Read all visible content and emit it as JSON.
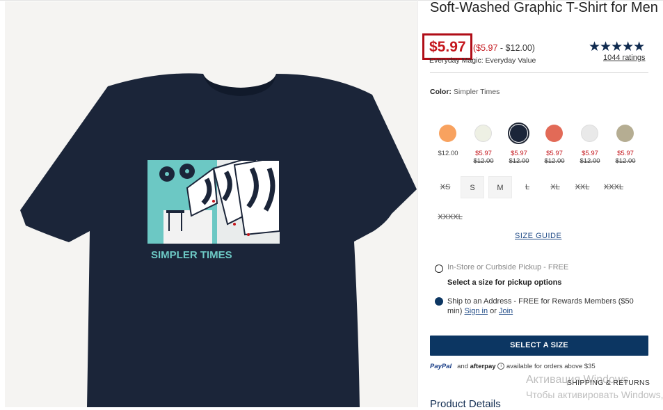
{
  "product": {
    "title": "Soft-Washed Graphic T-Shirt for Men",
    "sale_price": "$5.97",
    "range_low": "($5.97",
    "range_high": " - $12.00)",
    "value_label": "Everyday Magic: Everyday Value",
    "rating_stars": "★★★★★",
    "rating_count": "1044 ratings",
    "graphic_text": "SIMPLER TIMES",
    "image_alt": "Navy t-shirt with arcade graphic"
  },
  "color": {
    "label": "Color:",
    "selected_name": "Simpler Times",
    "swatches": [
      {
        "name": "orange",
        "hex": "#f8a25f",
        "price": "$12.00",
        "old_price": ""
      },
      {
        "name": "cream",
        "hex": "#eef0e4",
        "price": "$5.97",
        "old_price": "$12.00"
      },
      {
        "name": "navy",
        "hex": "#1b2539",
        "price": "$5.97",
        "old_price": "$12.00"
      },
      {
        "name": "coral-print",
        "hex": "#e26a57",
        "price": "$5.97",
        "old_price": "$12.00"
      },
      {
        "name": "light-gray",
        "hex": "#e9e9e9",
        "price": "$5.97",
        "old_price": "$12.00"
      },
      {
        "name": "camo-print",
        "hex": "#b5ad92",
        "price": "$5.97",
        "old_price": "$12.00"
      }
    ]
  },
  "sizes": [
    {
      "label": "XS",
      "available": false
    },
    {
      "label": "S",
      "available": true
    },
    {
      "label": "M",
      "available": true
    },
    {
      "label": "L",
      "available": false
    },
    {
      "label": "XL",
      "available": false
    },
    {
      "label": "XXL",
      "available": false
    },
    {
      "label": "XXXL",
      "available": false
    },
    {
      "label": "XXXXL",
      "available": false
    }
  ],
  "size_guide": "SIZE GUIDE",
  "fulfillment": {
    "pickup_label": "In-Store or Curbside Pickup - FREE",
    "pickup_note": "Select a size for pickup options",
    "ship_label": "Ship to an Address - FREE for Rewards Members ($50",
    "ship_min": "min)",
    "sign_in": "Sign in",
    "or": "or",
    "join": "Join"
  },
  "cta_label": "SELECT A SIZE",
  "payment": {
    "paypal": "PayPal",
    "and": "and",
    "afterpay": "afterpay",
    "note": "available for orders above $35"
  },
  "shipping_returns": "SHIPPING & RETURNS",
  "product_details": "Product Details",
  "watermark": {
    "line1": "Активация Windows",
    "line2": "Чтобы активировать Windows, перейдите в раздел \"Параметры\"."
  },
  "colors": {
    "brand_navy": "#0c3662",
    "sale_red": "#c4161c",
    "shirt_navy": "#1b2539",
    "graphic_teal": "#6cc8c4"
  }
}
